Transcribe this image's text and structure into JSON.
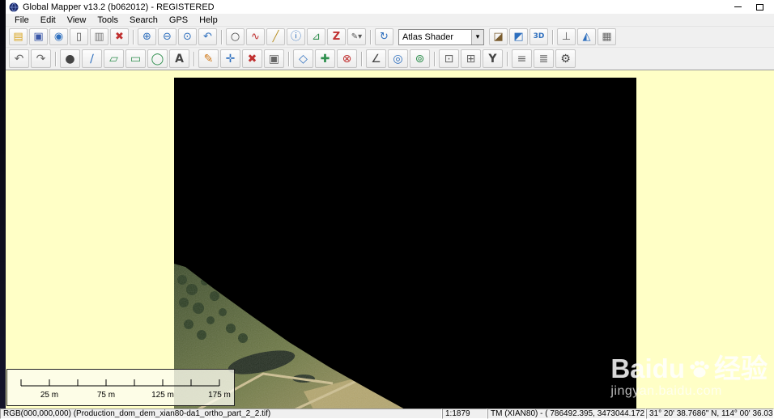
{
  "window": {
    "title": "Global Mapper v13.2 (b062012) - REGISTERED"
  },
  "menu_bar": {
    "items": [
      "File",
      "Edit",
      "View",
      "Tools",
      "Search",
      "GPS",
      "Help"
    ]
  },
  "toolbar_file": {
    "shader_selected": "Atlas Shader",
    "items": [
      {
        "name": "open-icon",
        "glyph": "▤",
        "style": "color:#d9a520"
      },
      {
        "name": "save-icon",
        "glyph": "▣",
        "style": "color:#3a57a8"
      },
      {
        "name": "open-workspace-icon",
        "glyph": "◉",
        "style": "color:#2e6fbe"
      },
      {
        "name": "open-datafile-icon",
        "glyph": "▯",
        "style": "color:#555555"
      },
      {
        "name": "metadata-icon",
        "glyph": "▥",
        "style": "color:#777777"
      },
      {
        "name": "unload-all-icon",
        "glyph": "✖",
        "style": "color:#c03030"
      },
      {
        "name": "zoom-in-icon",
        "glyph": "⊕",
        "style": "color:#2e6fbe"
      },
      {
        "name": "zoom-out-icon",
        "glyph": "⊖",
        "style": "color:#2e6fbe"
      },
      {
        "name": "full-extent-icon",
        "glyph": "⊙",
        "style": "color:#2e6fbe"
      },
      {
        "name": "previous-view-icon",
        "glyph": "↶",
        "style": "color:#2e6fbe"
      },
      {
        "name": "zoom-tool-icon",
        "glyph": "○",
        "style": "color:#444444"
      },
      {
        "name": "measure-tool-icon",
        "glyph": "∿",
        "style": "color:#c03030"
      },
      {
        "name": "digitizer-tool-icon",
        "glyph": "╱",
        "style": "color:#b8912a"
      },
      {
        "name": "feature-info-icon",
        "glyph": "ⓘ",
        "style": "color:#2e6fbe"
      },
      {
        "name": "path-profile-icon",
        "glyph": "⊿",
        "style": "color:#2f8f4e"
      },
      {
        "name": "3d-path-icon",
        "glyph": "Z",
        "style": "color:#c03030;font-weight:bold"
      },
      {
        "name": "style-pen-icon",
        "glyph": "✎▾",
        "style": "color:#555555;font-size:10px"
      },
      {
        "name": "recenter-icon",
        "glyph": "↻",
        "style": "color:#2e6fbe"
      },
      {
        "name": "hill-shading-icon",
        "glyph": "◪",
        "style": "color:#7a5c2e"
      },
      {
        "name": "water-shading-icon",
        "glyph": "◩",
        "style": "color:#2e6fbe"
      },
      {
        "name": "show-3d-icon",
        "glyph": "3D",
        "style": "color:#2e6fbe;font-weight:bold;font-size:9px"
      },
      {
        "name": "profile-line-icon",
        "glyph": "⊥",
        "style": "color:#555555"
      },
      {
        "name": "view-shed-icon",
        "glyph": "◭",
        "style": "color:#2e6fbe"
      },
      {
        "name": "grid-setup-icon",
        "glyph": "▦",
        "style": "color:#666666"
      }
    ]
  },
  "toolbar_digitizer": {
    "items": [
      {
        "name": "undo-icon",
        "glyph": "↶",
        "style": "color:#666666"
      },
      {
        "name": "redo-icon",
        "glyph": "↷",
        "style": "color:#666666"
      },
      {
        "name": "create-point-icon",
        "glyph": "●",
        "style": "color:#444444"
      },
      {
        "name": "create-line-icon",
        "glyph": "∕",
        "style": "color:#2e6fbe"
      },
      {
        "name": "create-area-icon",
        "glyph": "▱",
        "style": "color:#2f8f4e"
      },
      {
        "name": "create-rectangle-icon",
        "glyph": "▭",
        "style": "color:#2f8f4e"
      },
      {
        "name": "create-circle-icon",
        "glyph": "◯",
        "style": "color:#2f8f4e"
      },
      {
        "name": "create-text-icon",
        "glyph": "A",
        "style": "color:#444444;font-weight:bold"
      },
      {
        "name": "edit-feature-icon",
        "glyph": "✎",
        "style": "color:#d07818"
      },
      {
        "name": "move-feature-icon",
        "glyph": "✛",
        "style": "color:#2e6fbe"
      },
      {
        "name": "delete-feature-icon",
        "glyph": "✖",
        "style": "color:#c03030"
      },
      {
        "name": "copy-feature-icon",
        "glyph": "▣",
        "style": "color:#666666"
      },
      {
        "name": "vertex-edit-icon",
        "glyph": "◇",
        "style": "color:#2e6fbe"
      },
      {
        "name": "insert-vertex-icon",
        "glyph": "✚",
        "style": "color:#2f8f4e"
      },
      {
        "name": "delete-vertex-icon",
        "glyph": "⊗",
        "style": "color:#c03030"
      },
      {
        "name": "measure-angle-icon",
        "glyph": "∠",
        "style": "color:#444444"
      },
      {
        "name": "range-rings-icon",
        "glyph": "◎",
        "style": "color:#2e6fbe"
      },
      {
        "name": "buffer-icon",
        "glyph": "⊚",
        "style": "color:#2f8f4e"
      },
      {
        "name": "crop-icon",
        "glyph": "⊡",
        "style": "color:#666666"
      },
      {
        "name": "combine-areas-icon",
        "glyph": "⊞",
        "style": "color:#666666"
      },
      {
        "name": "split-line-icon",
        "glyph": "Y",
        "style": "color:#444444;font-weight:bold"
      },
      {
        "name": "snap-icon",
        "glyph": "≡",
        "style": "color:#666666"
      },
      {
        "name": "attributes-icon",
        "glyph": "≣",
        "style": "color:#666666"
      },
      {
        "name": "settings-icon",
        "glyph": "⚙",
        "style": "color:#444444"
      }
    ]
  },
  "map": {
    "colors": {
      "background": "#FFFFC6",
      "no_data_fill": "#000000",
      "toolbar": "#F0F0F0"
    },
    "scale_bar": {
      "labels": [
        "25 m",
        "75 m",
        "125 m",
        "175 m"
      ]
    },
    "watermark": {
      "brand": "Baidu",
      "brand_cn": "经验",
      "url": "jingyan.baidu.com"
    }
  },
  "status_bar": {
    "pixel_value": "RGB(000,000,000) (Production_dom_dem_xian80-da1_ortho_part_2_2.tif)",
    "scale": "1:1879",
    "projection": "TM (XIAN80) - ( 786492.395, 3473044.172 )",
    "coords": "31° 20' 38.7686\" N, 114° 00' 36.03\""
  }
}
